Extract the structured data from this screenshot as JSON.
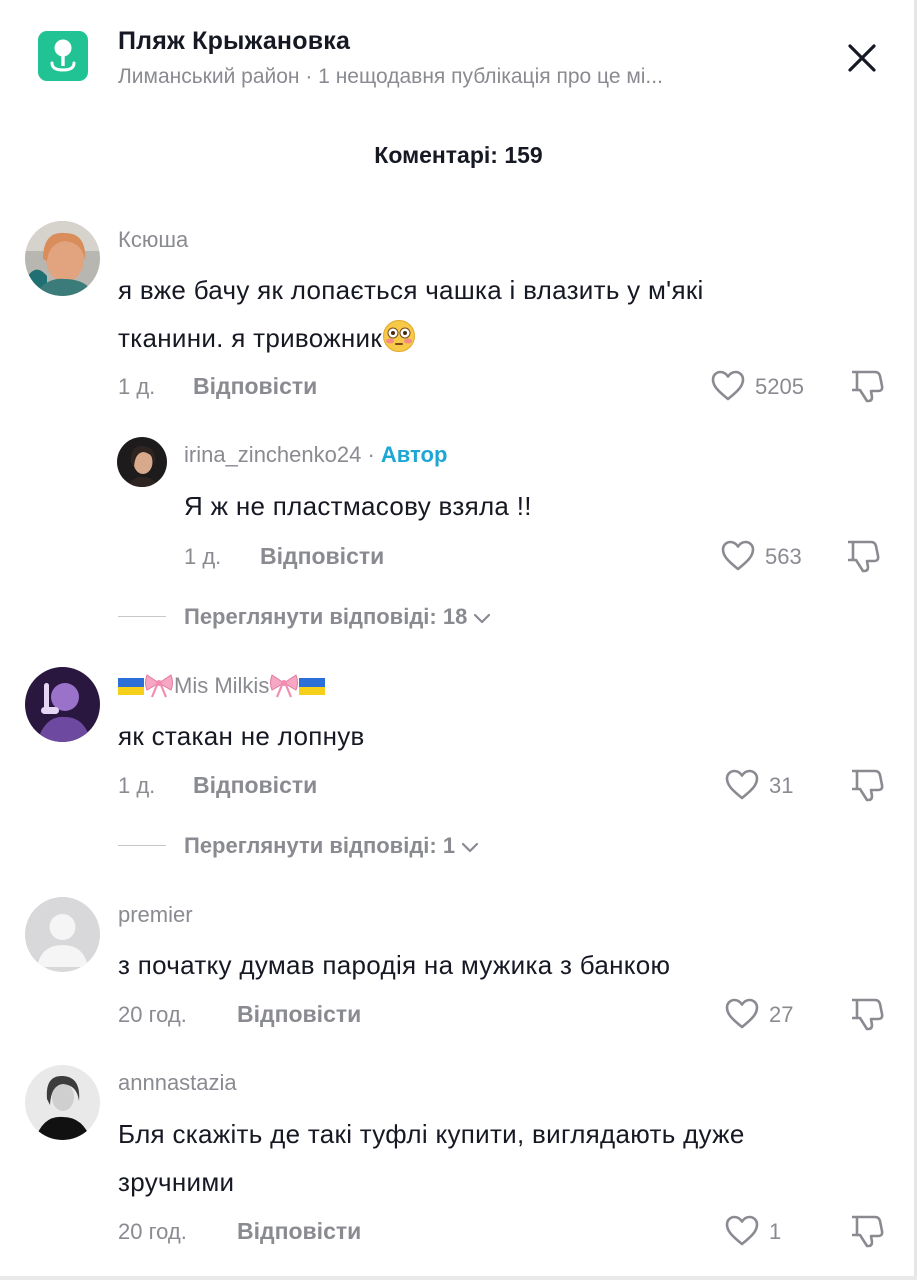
{
  "header": {
    "location_title": "Пляж Крыжановка",
    "location_subtitle": "Лиманський район · 1 нещодавня публікація про це мі...",
    "icons": {
      "location": "map-pin-icon",
      "close": "close-icon"
    },
    "accent_color": "#21c394"
  },
  "comments_count_label": "Коментарі: 159",
  "reply_label": "Відповісти",
  "author_badge": "Автор",
  "comments": [
    {
      "username": "Ксюша",
      "text_line1": "я вже бачу як лопається чашка і влазить у м'які",
      "text_line2": "тканини. я тривожник",
      "emoji": "flushed-face-emoji",
      "time": "1 д.",
      "likes": "5205"
    },
    {
      "username": "irina_zinchenko24",
      "separator": " · ",
      "is_author": true,
      "text": "Я ж не пластмасову взяла !!",
      "time": "1 д.",
      "likes": "563"
    },
    {
      "username": "Mis Milkis",
      "username_decor": [
        "ukraine-flag",
        "pink-bow",
        "pink-bow",
        "ukraine-flag"
      ],
      "text": "як стакан не лопнув",
      "time": "1 д.",
      "likes": "31"
    },
    {
      "username": "premier",
      "text": "з початку думав пародія на мужика з банкою",
      "time": "20 год.",
      "likes": "27"
    },
    {
      "username": "annnastazia",
      "text_line1": "Бля скажіть де такі туфлі купити, виглядають дуже",
      "text_line2": "зручними",
      "time": "20 год.",
      "likes": "1"
    }
  ],
  "view_replies": [
    {
      "label": "Переглянути відповіді: 18"
    },
    {
      "label": "Переглянути відповіді: 1"
    }
  ]
}
